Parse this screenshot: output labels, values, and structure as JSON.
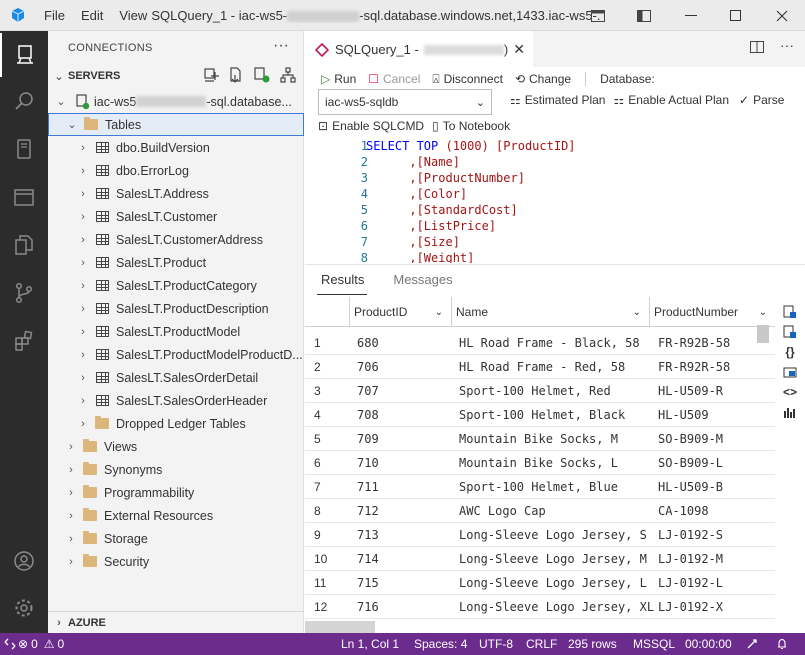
{
  "titlebar": {
    "menu": [
      "File",
      "Edit",
      "View"
    ],
    "title_prefix": "SQLQuery_1 - iac-ws5-",
    "title_suffix": "-sql.database.windows.net,1433.iac-ws5-..."
  },
  "sidebar": {
    "header": "CONNECTIONS",
    "more": "···",
    "servers_label": "SERVERS",
    "server_name_prefix": "iac-ws5",
    "server_name_suffix": "-sql.database...",
    "tree": [
      {
        "label": "Tables",
        "type": "folder",
        "level": 1,
        "expanded": true,
        "selected": true
      },
      {
        "label": "dbo.BuildVersion",
        "type": "table",
        "level": 2
      },
      {
        "label": "dbo.ErrorLog",
        "type": "table",
        "level": 2
      },
      {
        "label": "SalesLT.Address",
        "type": "table",
        "level": 2
      },
      {
        "label": "SalesLT.Customer",
        "type": "table",
        "level": 2
      },
      {
        "label": "SalesLT.CustomerAddress",
        "type": "table",
        "level": 2
      },
      {
        "label": "SalesLT.Product",
        "type": "table",
        "level": 2
      },
      {
        "label": "SalesLT.ProductCategory",
        "type": "table",
        "level": 2
      },
      {
        "label": "SalesLT.ProductDescription",
        "type": "table",
        "level": 2
      },
      {
        "label": "SalesLT.ProductModel",
        "type": "table",
        "level": 2
      },
      {
        "label": "SalesLT.ProductModelProductD...",
        "type": "table",
        "level": 2
      },
      {
        "label": "SalesLT.SalesOrderDetail",
        "type": "table",
        "level": 2
      },
      {
        "label": "SalesLT.SalesOrderHeader",
        "type": "table",
        "level": 2
      },
      {
        "label": "Dropped Ledger Tables",
        "type": "folder",
        "level": 2
      },
      {
        "label": "Views",
        "type": "folder",
        "level": 1
      },
      {
        "label": "Synonyms",
        "type": "folder",
        "level": 1
      },
      {
        "label": "Programmability",
        "type": "folder",
        "level": 1
      },
      {
        "label": "External Resources",
        "type": "folder",
        "level": 1
      },
      {
        "label": "Storage",
        "type": "folder",
        "level": 1
      },
      {
        "label": "Security",
        "type": "folder",
        "level": 1
      }
    ],
    "azure_label": "AZURE"
  },
  "editor": {
    "tab_title": "SQLQuery_1 -",
    "tab_suffix": ")",
    "toolbar": {
      "run": "Run",
      "cancel": "Cancel",
      "disconnect": "Disconnect",
      "change": "Change",
      "database_label": "Database:",
      "database_value": "iac-ws5-sqldb",
      "estimated_plan": "Estimated Plan",
      "enable_actual_plan": "Enable Actual Plan",
      "parse": "Parse",
      "enable_sqlcmd": "Enable SQLCMD",
      "to_notebook": "To Notebook"
    },
    "code_lines": [
      {
        "n": "1",
        "kw": "SELECT TOP ",
        "rest": "(1000) [ProductID]"
      },
      {
        "n": "2",
        "kw": "",
        "rest": "      ,[Name]"
      },
      {
        "n": "3",
        "kw": "",
        "rest": "      ,[ProductNumber]"
      },
      {
        "n": "4",
        "kw": "",
        "rest": "      ,[Color]"
      },
      {
        "n": "5",
        "kw": "",
        "rest": "      ,[StandardCost]"
      },
      {
        "n": "6",
        "kw": "",
        "rest": "      ,[ListPrice]"
      },
      {
        "n": "7",
        "kw": "",
        "rest": "      ,[Size]"
      },
      {
        "n": "8",
        "kw": "",
        "rest": "      ,[Weight]"
      }
    ]
  },
  "results": {
    "tabs": [
      "Results",
      "Messages"
    ],
    "columns": [
      "ProductID",
      "Name",
      "ProductNumber"
    ],
    "rows": [
      [
        "1",
        "680",
        "HL Road Frame - Black, 58",
        "FR-R92B-58"
      ],
      [
        "2",
        "706",
        "HL Road Frame - Red, 58",
        "FR-R92R-58"
      ],
      [
        "3",
        "707",
        "Sport-100 Helmet, Red",
        "HL-U509-R"
      ],
      [
        "4",
        "708",
        "Sport-100 Helmet, Black",
        "HL-U509"
      ],
      [
        "5",
        "709",
        "Mountain Bike Socks, M",
        "SO-B909-M"
      ],
      [
        "6",
        "710",
        "Mountain Bike Socks, L",
        "SO-B909-L"
      ],
      [
        "7",
        "711",
        "Sport-100 Helmet, Blue",
        "HL-U509-B"
      ],
      [
        "8",
        "712",
        "AWC Logo Cap",
        "CA-1098"
      ],
      [
        "9",
        "713",
        "Long-Sleeve Logo Jersey, S",
        "LJ-0192-S"
      ],
      [
        "10",
        "714",
        "Long-Sleeve Logo Jersey, M",
        "LJ-0192-M"
      ],
      [
        "11",
        "715",
        "Long-Sleeve Logo Jersey, L",
        "LJ-0192-L"
      ],
      [
        "12",
        "716",
        "Long-Sleeve Logo Jersey, XL",
        "LJ-0192-X"
      ]
    ]
  },
  "statusbar": {
    "errors": "0",
    "warnings": "0",
    "position": "Ln 1, Col 1",
    "spaces": "Spaces: 4",
    "encoding": "UTF-8",
    "eol": "CRLF",
    "rows": "295 rows",
    "language": "MSSQL",
    "elapsed": "00:00:00"
  },
  "colors": {
    "statusbar": "#6c2c8e",
    "activitybar": "#2c2c2c",
    "selection_border": "#3d7bd6",
    "run_green": "#388a34"
  }
}
